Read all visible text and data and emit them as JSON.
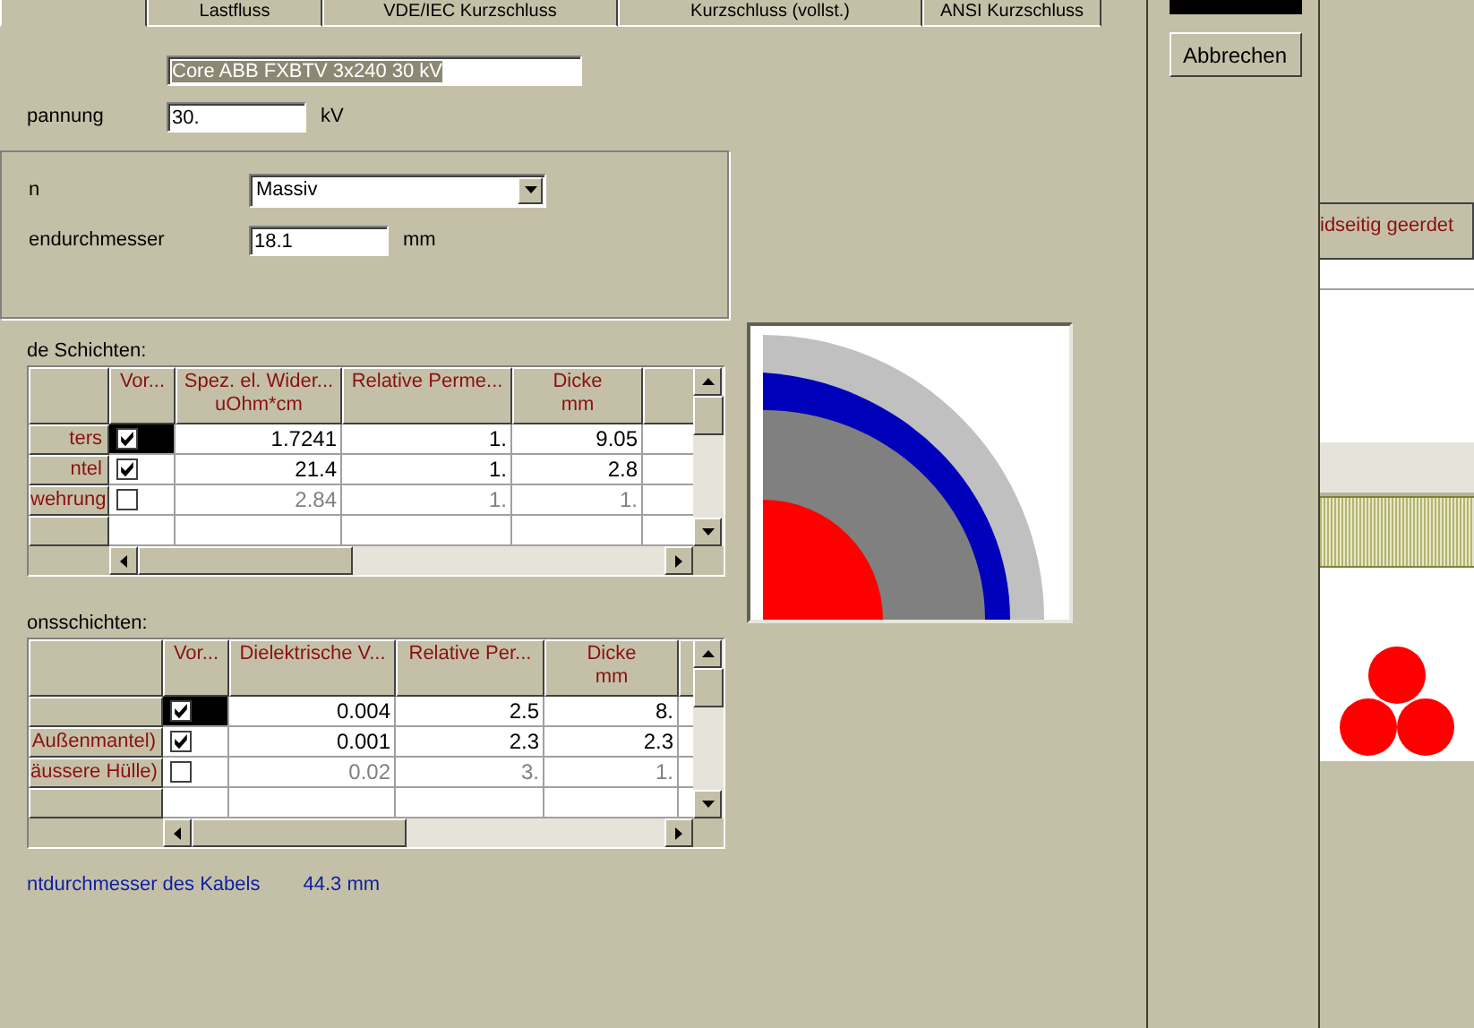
{
  "tabs": [
    {
      "selected": true
    },
    {
      "label": "Lastfluss",
      "selected": false
    },
    {
      "label": "VDE/IEC Kurzschluss",
      "selected": false
    },
    {
      "label": "Kurzschluss (vollst.)",
      "selected": false
    },
    {
      "label": "ANSI Kurzschluss",
      "selected": false
    }
  ],
  "cable_name": "Core ABB FXBTV 3x240 30 kV",
  "voltage": {
    "label": "pannung",
    "value": "30.",
    "unit": "kV"
  },
  "conductor": {
    "type_label": "n",
    "type_value": "Massiv",
    "diameter_label": "endurchmesser",
    "diameter_value": "18.1",
    "unit": "mm"
  },
  "conductive_layers": {
    "title": "de Schichten:",
    "columns": [
      {
        "title": "Vor..."
      },
      {
        "title": "Spez. el. Wider...",
        "unit": "uOhm*cm"
      },
      {
        "title": "Relative Perme..."
      },
      {
        "title": "Dicke",
        "unit": "mm"
      }
    ],
    "rows": [
      {
        "name": "ters",
        "checked": true,
        "selected": true,
        "disabled": false,
        "values": [
          "1.7241",
          "1.",
          "9.05"
        ]
      },
      {
        "name": "ntel",
        "checked": true,
        "selected": false,
        "disabled": false,
        "values": [
          "21.4",
          "1.",
          "2.8"
        ]
      },
      {
        "name": "wehrung",
        "checked": false,
        "selected": false,
        "disabled": true,
        "values": [
          "2.84",
          "1.",
          "1."
        ]
      }
    ]
  },
  "insulation_layers": {
    "title": "onsschichten:",
    "columns": [
      {
        "title": "Vor..."
      },
      {
        "title": "Dielektrische V..."
      },
      {
        "title": "Relative Per..."
      },
      {
        "title": "Dicke",
        "unit": "mm"
      }
    ],
    "rows": [
      {
        "name": "",
        "checked": true,
        "selected": true,
        "disabled": false,
        "values": [
          "0.004",
          "2.5",
          "8."
        ]
      },
      {
        "name": "Außenmantel)",
        "checked": true,
        "selected": false,
        "disabled": false,
        "values": [
          "0.001",
          "2.3",
          "2.3"
        ]
      },
      {
        "name": "äussere Hülle)",
        "checked": false,
        "selected": false,
        "disabled": true,
        "values": [
          "0.02",
          "3.",
          "1."
        ]
      }
    ]
  },
  "total": {
    "label": "ntdurchmesser des Kabels",
    "value": "44.3 mm"
  },
  "cancel_button": "Abbrechen",
  "side_table": {
    "column_1": "idseitig geerdet"
  }
}
